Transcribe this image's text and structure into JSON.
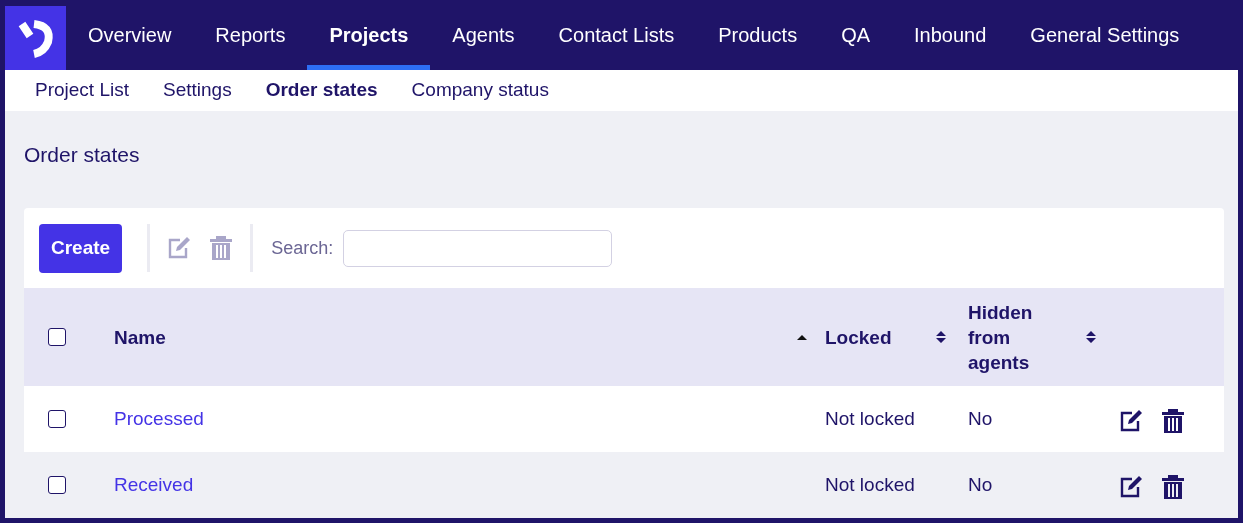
{
  "nav": [
    {
      "label": "Overview",
      "selected": false
    },
    {
      "label": "Reports",
      "selected": false
    },
    {
      "label": "Projects",
      "selected": true
    },
    {
      "label": "Agents",
      "selected": false
    },
    {
      "label": "Contact Lists",
      "selected": false
    },
    {
      "label": "Products",
      "selected": false
    },
    {
      "label": "QA",
      "selected": false
    },
    {
      "label": "Inbound",
      "selected": false
    },
    {
      "label": "General Settings",
      "selected": false
    }
  ],
  "subnav": [
    {
      "label": "Project List",
      "selected": false
    },
    {
      "label": "Settings",
      "selected": false
    },
    {
      "label": "Order states",
      "selected": true
    },
    {
      "label": "Company status",
      "selected": false
    }
  ],
  "page_title": "Order states",
  "toolbar": {
    "create_label": "Create",
    "edit_disabled": true,
    "delete_disabled": true,
    "search_label": "Search:"
  },
  "table": {
    "select_all_checked": false,
    "columns": [
      {
        "label": "Name",
        "sorted": true
      },
      {
        "label": "Locked",
        "sorted": false
      },
      {
        "label": "Hidden from agents",
        "sorted": false
      }
    ],
    "rows": [
      {
        "checked": false,
        "name": "Processed",
        "locked": "Not locked",
        "hidden": "No"
      },
      {
        "checked": false,
        "name": "Received",
        "locked": "Not locked",
        "hidden": "No"
      }
    ]
  }
}
